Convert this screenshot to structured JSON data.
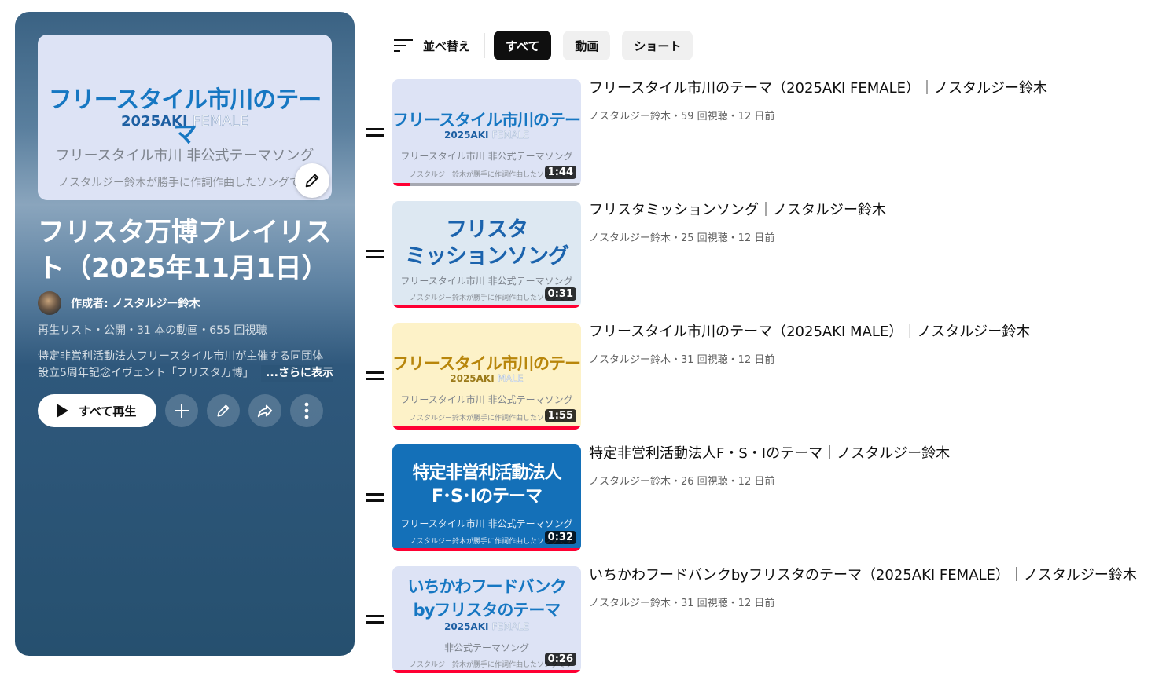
{
  "playlist": {
    "cover": {
      "line1": "フリースタイル市川のテーマ",
      "line2_main": "2025AKI",
      "line2_alt": "FEMALE",
      "line3": "フリースタイル市川 非公式テーマソング",
      "line4": "ノスタルジー鈴木が勝手に作詞作曲したソングです"
    },
    "title": "フリスタ万博プレイリスト（2025年11月1日）",
    "owner": "作成者: ノスタルジー鈴木",
    "meta": "再生リスト・公開・31 本の動画・655 回視聴",
    "description_line1": "特定非営利活動法人フリースタイル市川が主催する同団体",
    "description_line2": "設立5周年記念イヴェント「フリスタ万博」",
    "show_more": "...さらに表示",
    "play_all_label": "すべて再生"
  },
  "filters": {
    "sort_label": "並べ替え",
    "chips": [
      "すべて",
      "動画",
      "ショート"
    ]
  },
  "colors": {
    "accent_red": "#ff0033",
    "active_chip": "#0f0f0f",
    "panel_blue": "#2f587c"
  },
  "videos": [
    {
      "title": "フリースタイル市川のテーマ（2025AKI FEMALE）｜ノスタルジー鈴木",
      "meta": "ノスタルジー鈴木・59 回視聴・12 日前",
      "duration": "1:44",
      "progress": 0.09,
      "thumb": {
        "line1": "フリースタイル市川のテーマ",
        "line2_main": "2025AKI",
        "line2_alt": "FEMALE",
        "line3": "フリースタイル市川 非公式テーマソング",
        "line4": "ノスタルジー鈴木が勝手に作詞作曲したソングです"
      }
    },
    {
      "title": "フリスタミッションソング｜ノスタルジー鈴木",
      "meta": "ノスタルジー鈴木・25 回視聴・12 日前",
      "duration": "0:31",
      "progress": 1.0,
      "thumb": {
        "line1": "フリスタ",
        "line1b": "ミッションソング",
        "line3": "フリースタイル市川 非公式テーマソング",
        "line4": "ノスタルジー鈴木が勝手に作詞作曲したソングです"
      }
    },
    {
      "title": "フリースタイル市川のテーマ（2025AKI MALE）｜ノスタルジー鈴木",
      "meta": "ノスタルジー鈴木・31 回視聴・12 日前",
      "duration": "1:55",
      "progress": 1.0,
      "thumb": {
        "line1": "フリースタイル市川のテーマ",
        "line2_main": "2025AKI",
        "line2_alt": "MALE",
        "line3": "フリースタイル市川 非公式テーマソング",
        "line4": "ノスタルジー鈴木が勝手に作詞作曲したソングです"
      }
    },
    {
      "title": "特定非営利活動法人F・S・Iのテーマ｜ノスタルジー鈴木",
      "meta": "ノスタルジー鈴木・26 回視聴・12 日前",
      "duration": "0:32",
      "progress": 1.0,
      "thumb": {
        "line1": "特定非営利活動法人",
        "line1b": "F･S･Iのテーマ",
        "line3": "フリースタイル市川 非公式テーマソング",
        "line4": "ノスタルジー鈴木が勝手に作詞作曲したソングです"
      }
    },
    {
      "title": "いちかわフードバンクbyフリスタのテーマ（2025AKI FEMALE）｜ノスタルジー鈴木",
      "meta": "ノスタルジー鈴木・31 回視聴・12 日前",
      "duration": "0:26",
      "progress": 1.0,
      "thumb": {
        "line1": "いちかわフードバンク",
        "line1b": "byフリスタのテーマ",
        "line2_main": "2025AKI",
        "line2_alt": "FEMALE",
        "line3": "非公式テーマソング",
        "line4": "ノスタルジー鈴木が勝手に作詞作曲したソングです"
      }
    }
  ]
}
